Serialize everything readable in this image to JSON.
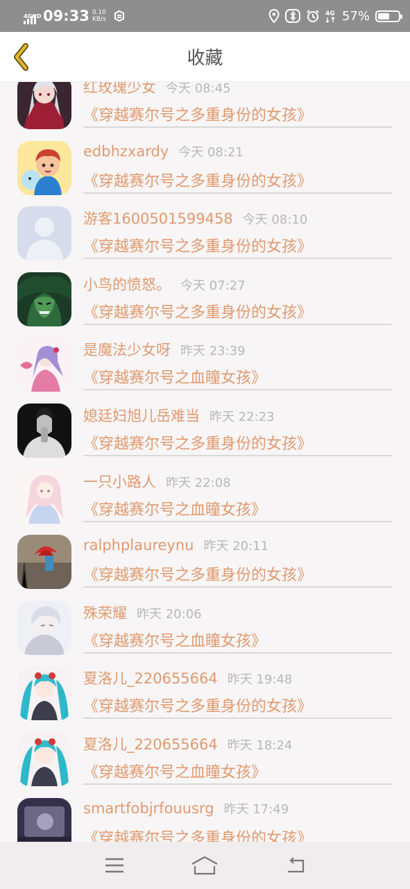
{
  "status_bar": {
    "network_type": "4GHD",
    "time": "09:33",
    "speed_value": "0.10",
    "speed_unit": "KB/s",
    "battery_percent": "57%",
    "battery_level": 0.57,
    "icons": [
      "location-icon",
      "bluetooth-icon",
      "alarm-icon",
      "4g-icon"
    ]
  },
  "header": {
    "title": "收藏",
    "back_icon": "chevron-left-icon",
    "accent_color": "#e0b72a"
  },
  "favorites": [
    {
      "name": "红玫瑰少女",
      "time": "今天 08:45",
      "title": "《穿越赛尔号之多重身份的女孩》",
      "avatar": "anime-girl-red"
    },
    {
      "name": "edbhzxardy",
      "time": "今天 08:21",
      "title": "《穿越赛尔号之多重身份的女孩》",
      "avatar": "cartoon-boy"
    },
    {
      "name": "游客1600501599458",
      "time": "今天 08:10",
      "title": "《穿越赛尔号之多重身份的女孩》",
      "avatar": "default-user"
    },
    {
      "name": "小鸟的愤怒。",
      "time": "今天 07:27",
      "title": "《穿越赛尔号之多重身份的女孩》",
      "avatar": "anime-man-green"
    },
    {
      "name": "是魔法少女呀",
      "time": "昨天 23:39",
      "title": "《穿越赛尔号之血瞳女孩》",
      "avatar": "magical-girl"
    },
    {
      "name": "媳廷妇旭儿岳难当",
      "time": "昨天 22:23",
      "title": "《穿越赛尔号之多重身份的女孩》",
      "avatar": "bw-man"
    },
    {
      "name": "一只小路人",
      "time": "昨天 22:08",
      "title": "《穿越赛尔号之血瞳女孩》",
      "avatar": "pastel-girl"
    },
    {
      "name": "ralphplaureynu",
      "time": "昨天 20:11",
      "title": "《穿越赛尔号之多重身份的女孩》",
      "avatar": "umbrella-photo"
    },
    {
      "name": "殊荣耀",
      "time": "昨天 20:06",
      "title": "《穿越赛尔号之血瞳女孩》",
      "avatar": "white-hair-boy"
    },
    {
      "name": "夏洛儿_220655664",
      "time": "昨天 19:48",
      "title": "《穿越赛尔号之多重身份的女孩》",
      "avatar": "miku-girl"
    },
    {
      "name": "夏洛儿_220655664",
      "time": "昨天 18:24",
      "title": "《穿越赛尔号之血瞳女孩》",
      "avatar": "miku-girl"
    },
    {
      "name": "smartfobjrfouusrg",
      "time": "昨天 17:49",
      "title": "《穿越赛尔号之多重身份的女孩》",
      "avatar": "dark-photo"
    }
  ],
  "colors": {
    "name_color": "#e09a6f",
    "time_color": "#b8b8b8",
    "status_bar_bg": "#8e8e8e"
  },
  "nav_bar": {
    "icons": [
      "menu-icon",
      "home-icon",
      "back-icon"
    ]
  }
}
